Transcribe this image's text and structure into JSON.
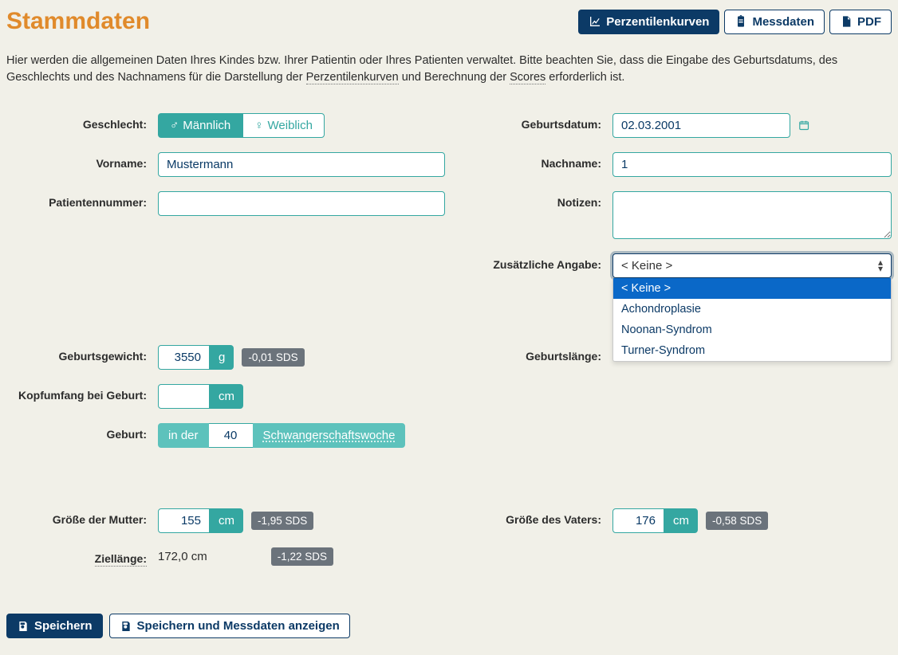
{
  "title": "Stammdaten",
  "headerButtons": {
    "curves": "Perzentilenkurven",
    "measurements": "Messdaten",
    "pdf": "PDF"
  },
  "intro": {
    "pre": "Hier werden die allgemeinen Daten Ihres Kindes bzw. Ihrer Patientin oder Ihres Patienten verwaltet. Bitte beachten Sie, dass die Eingabe des Geburtsdatums, des Geschlechts und des Nachnamens für die Darstellung der ",
    "link1": "Perzentilenkurven",
    "mid": " und Berechnung der ",
    "link2": "Scores",
    "post": " erforderlich ist."
  },
  "labels": {
    "gender": "Geschlecht:",
    "birthdate": "Geburtsdatum:",
    "firstname": "Vorname:",
    "lastname": "Nachname:",
    "patientno": "Patientennummer:",
    "notes": "Notizen:",
    "extra": "Zusätzliche Angabe:",
    "birthweight": "Geburtsgewicht:",
    "birthlength": "Geburtslänge:",
    "headcirc": "Kopfumfang bei Geburt:",
    "birth": "Geburt:",
    "motherheight": "Größe der Mutter:",
    "fatherheight": "Größe des Vaters:",
    "targetheight": "Ziellänge:"
  },
  "gender": {
    "male": "Männlich",
    "female": "Weiblich",
    "selected": "male"
  },
  "values": {
    "birthdate": "02.03.2001",
    "firstname": "Mustermann",
    "lastname": "1",
    "patientno": "",
    "notes": "",
    "birthweight": "3550",
    "headcirc": "",
    "pregnancyweek": "40",
    "motherheight": "155",
    "fatherheight": "176",
    "targetheight": "172,0 cm"
  },
  "units": {
    "g": "g",
    "cm": "cm"
  },
  "pregnancy": {
    "lead": "in der",
    "trail": "Schwangerschaftswoche"
  },
  "sds": {
    "birthweight": "-0,01 SDS",
    "motherheight": "-1,95 SDS",
    "fatherheight": "-0,58 SDS",
    "targetheight": "-1,22 SDS"
  },
  "extra": {
    "selected": "< Keine >",
    "options": [
      "< Keine >",
      "Achondroplasie",
      "Noonan-Syndrom",
      "Turner-Syndrom"
    ]
  },
  "footer": {
    "save": "Speichern",
    "saveAndShow": "Speichern und Messdaten anzeigen"
  }
}
